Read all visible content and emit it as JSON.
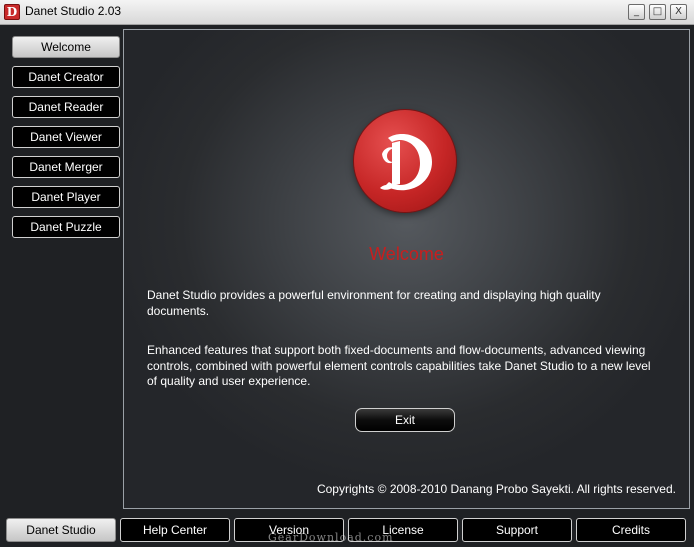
{
  "window": {
    "title": "Danet Studio 2.03",
    "icon": "danet-d-logo-icon",
    "controls": {
      "minimize": "_",
      "maximize": "□",
      "close": "X"
    }
  },
  "sidebar": {
    "items": [
      {
        "label": "Welcome",
        "active": true
      },
      {
        "label": "Danet Creator",
        "active": false
      },
      {
        "label": "Danet Reader",
        "active": false
      },
      {
        "label": "Danet Viewer",
        "active": false
      },
      {
        "label": "Danet Merger",
        "active": false
      },
      {
        "label": "Danet Player",
        "active": false
      },
      {
        "label": "Danet Puzzle",
        "active": false
      }
    ]
  },
  "main": {
    "logo_icon": "danet-d-logo-icon",
    "heading": "Welcome",
    "paragraph_1": "Danet Studio provides a powerful environment for creating and displaying high quality documents.",
    "paragraph_2": "Enhanced features that support both fixed-documents and flow-documents, advanced viewing controls, combined with powerful element controls capabilities take Danet Studio to a new level of quality and user experience.",
    "exit_label": "Exit",
    "copyright": "Copyrights © 2008-2010 Danang Probo Sayekti. All rights reserved."
  },
  "bottom_tabs": [
    {
      "label": "Danet Studio",
      "active": true
    },
    {
      "label": "Help Center",
      "active": false
    },
    {
      "label": "Version",
      "active": false
    },
    {
      "label": "License",
      "active": false
    },
    {
      "label": "Support",
      "active": false
    },
    {
      "label": "Credits",
      "active": false
    }
  ],
  "watermark": "GearDownload.com",
  "colors": {
    "accent_red": "#c81e1e",
    "background": "#1f2124",
    "button_black": "#000000"
  }
}
